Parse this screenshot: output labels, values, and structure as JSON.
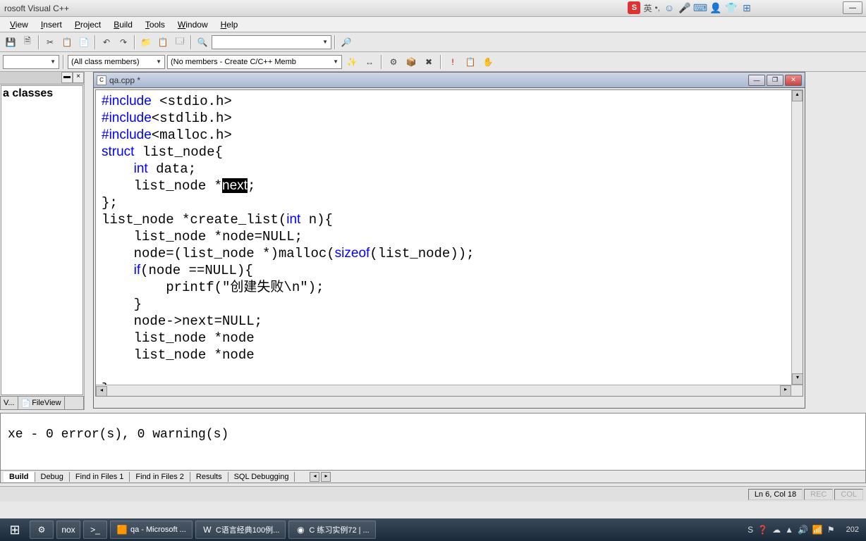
{
  "titlebar": {
    "title": "rosoft Visual C++"
  },
  "ime": {
    "badge": "S",
    "lang": "英",
    "icons": [
      "☺",
      "🎤",
      "⌨",
      "👤",
      "👕",
      "⊞"
    ]
  },
  "menu": [
    "View",
    "Insert",
    "Project",
    "Build",
    "Tools",
    "Window",
    "Help"
  ],
  "toolbar2": {
    "combo1": "",
    "combo2": "(All class members)",
    "combo3": "(No members - Create C/C++ Memb"
  },
  "sidebar": {
    "tree_text": "a classes",
    "tab_v": "V...",
    "tab_file": "FileView"
  },
  "codewin": {
    "filename": "qa.cpp *",
    "code_lines": [
      {
        "t": "#include",
        "cls": "kw",
        "rest": " <stdio.h>"
      },
      {
        "t": "#include",
        "cls": "kw",
        "rest": "<stdlib.h>"
      },
      {
        "t": "#include",
        "cls": "kw",
        "rest": "<malloc.h>"
      },
      {
        "t": "struct",
        "cls": "kw",
        "rest": " list_node{"
      },
      {
        "indent": "    ",
        "t": "int",
        "cls": "kw",
        "rest": " data;"
      },
      {
        "indent": "    ",
        "plain": "list_node *",
        "sel": "next",
        "tail": ";"
      },
      {
        "plain": "};"
      },
      {
        "plain": "list_node *create_list(",
        "t": "int",
        "cls": "kw",
        "tail": " n){"
      },
      {
        "indent": "    ",
        "plain": "list_node *node=NULL;"
      },
      {
        "indent": "    ",
        "plain": "node=(list_node *)malloc(",
        "t": "sizeof",
        "cls": "kw",
        "tail": "(list_node));"
      },
      {
        "indent": "    ",
        "t": "if",
        "cls": "kw",
        "rest": "(node ==NULL){"
      },
      {
        "indent": "        ",
        "plain": "printf(\"创建失败\\n\");"
      },
      {
        "indent": "    ",
        "plain": "}"
      },
      {
        "indent": "    ",
        "plain": "node->next=NULL;"
      },
      {
        "indent": "    ",
        "plain": "list_node *node"
      },
      {
        "indent": "    ",
        "plain": "list_node *node"
      },
      {
        "plain": ""
      },
      {
        "plain": "}"
      }
    ]
  },
  "output": {
    "text": "xe - 0 error(s), 0 warning(s)",
    "tabs": [
      "Build",
      "Debug",
      "Find in Files 1",
      "Find in Files 2",
      "Results",
      "SQL Debugging"
    ]
  },
  "statusbar": {
    "pos": "Ln 6, Col 18",
    "rec": "REC",
    "col": "COL"
  },
  "taskbar": {
    "items": [
      {
        "icon": "⚙",
        "label": ""
      },
      {
        "icon": "nox",
        "label": ""
      },
      {
        "icon": ">_",
        "label": ""
      },
      {
        "icon": "🟧",
        "label": "qa - Microsoft ..."
      },
      {
        "icon": "W",
        "label": "C语言经典100例..."
      },
      {
        "icon": "◉",
        "label": "C 练习实例72 | ..."
      }
    ],
    "tray": [
      "S",
      "❓",
      "☁",
      "▲",
      "🔊",
      "📶",
      "⚑"
    ],
    "clock": "202"
  }
}
